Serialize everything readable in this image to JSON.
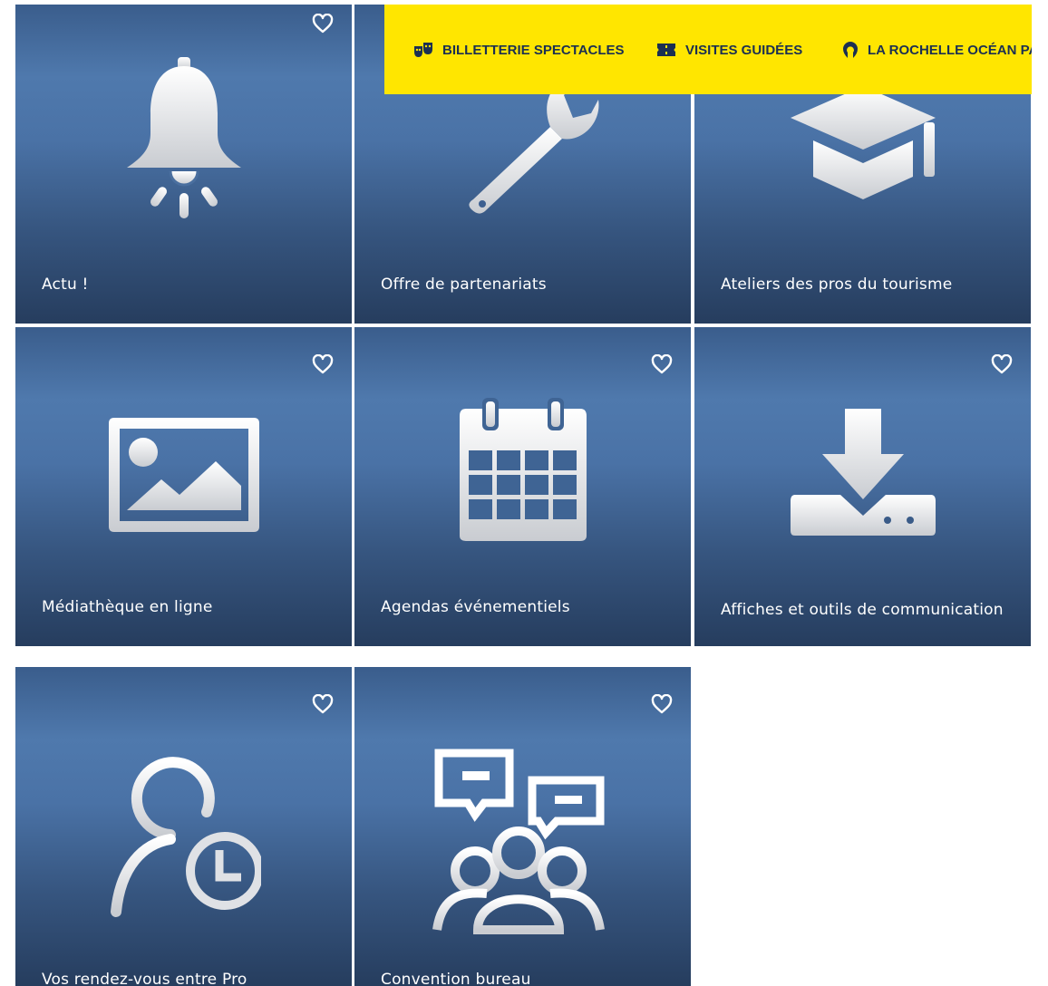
{
  "tiles": [
    {
      "label": "Actu !",
      "icon": "bell-icon",
      "favorite": "heart-icon"
    },
    {
      "label": "Offre de partenariats",
      "icon": "wrench-icon",
      "favorite": "heart-icon"
    },
    {
      "label": "Ateliers des pros du tourisme",
      "icon": "graduation-cap-icon",
      "favorite": "heart-icon"
    },
    {
      "label": "Médiathèque en ligne",
      "icon": "image-icon",
      "favorite": "heart-icon"
    },
    {
      "label": "Agendas événementiels",
      "icon": "calendar-icon",
      "favorite": "heart-icon"
    },
    {
      "label": "Affiches et outils de communication",
      "icon": "download-icon",
      "favorite": "heart-icon"
    },
    {
      "label": "Vos rendez-vous entre Pro",
      "icon": "user-clock-icon",
      "favorite": "heart-icon"
    },
    {
      "label": "Convention bureau",
      "icon": "meeting-group-icon",
      "favorite": "heart-icon"
    }
  ],
  "topbar": {
    "items": [
      {
        "label": "BILLETTERIE SPECTACLES",
        "icon": "theater-masks-icon"
      },
      {
        "label": "VISITES GUIDÉES",
        "icon": "ticket-icon"
      },
      {
        "label": "LA ROCHELLE OCÉAN PASS",
        "icon": "location-pin-icon"
      }
    ]
  },
  "colors": {
    "tile_top": "#4f79ad",
    "tile_bottom": "#263d5e",
    "topbar_bg": "#ffe600",
    "topbar_text": "#1b2f52"
  }
}
